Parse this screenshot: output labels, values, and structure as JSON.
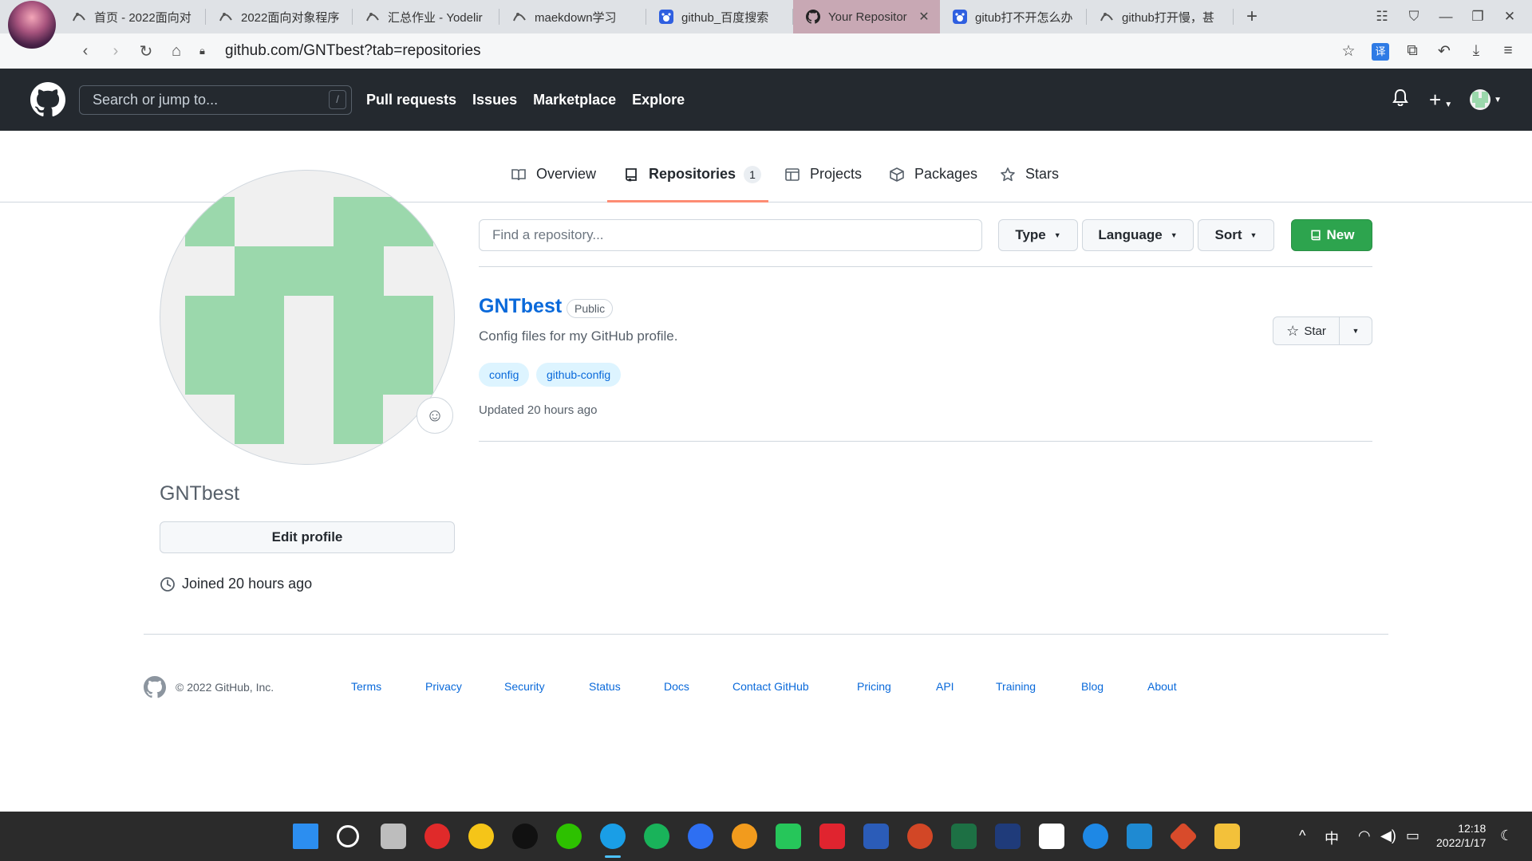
{
  "browser": {
    "tabs": [
      {
        "label": "首页 - 2022面向对",
        "icon": "yuque-icon",
        "active": false,
        "show_close": false
      },
      {
        "label": "2022面向对象程序",
        "icon": "yuque-icon",
        "active": false,
        "show_close": false
      },
      {
        "label": "汇总作业 - Yodelir",
        "icon": "yuque-icon",
        "active": false,
        "show_close": false
      },
      {
        "label": "maekdown学习",
        "icon": "yuque-icon",
        "active": false,
        "show_close": false
      },
      {
        "label": "github_百度搜索",
        "icon": "baidu-icon",
        "active": false,
        "show_close": false
      },
      {
        "label": "Your Repositor",
        "icon": "github-icon",
        "active": true,
        "show_close": true
      },
      {
        "label": "gitub打不开怎么办",
        "icon": "baidu-icon",
        "active": false,
        "show_close": false
      },
      {
        "label": "github打开慢，甚",
        "icon": "yuque-icon",
        "active": false,
        "show_close": false
      }
    ],
    "new_tab_glyph": "+",
    "url": "github.com/GNTbest?tab=repositories",
    "translate_label": "译"
  },
  "header": {
    "search_placeholder": "Search or jump to...",
    "search_shortcut": "/",
    "nav": [
      "Pull requests",
      "Issues",
      "Marketplace",
      "Explore"
    ]
  },
  "profile_tabs": {
    "overview": "Overview",
    "repositories": "Repositories",
    "repositories_count": "1",
    "projects": "Projects",
    "packages": "Packages",
    "stars": "Stars"
  },
  "profile": {
    "username": "GNTbest",
    "edit_label": "Edit profile",
    "joined": "Joined 20 hours ago",
    "avatar_color": "#9bd8ac"
  },
  "repo_filters": {
    "find_placeholder": "Find a repository...",
    "type_label": "Type",
    "language_label": "Language",
    "sort_label": "Sort",
    "new_label": "New"
  },
  "repo": {
    "name": "GNTbest",
    "visibility": "Public",
    "description": "Config files for my GitHub profile.",
    "topics": [
      "config",
      "github-config"
    ],
    "updated": "Updated 20 hours ago",
    "star_label": "Star"
  },
  "footer": {
    "copyright": "© 2022 GitHub, Inc.",
    "links": [
      "Terms",
      "Privacy",
      "Security",
      "Status",
      "Docs",
      "Contact GitHub",
      "Pricing",
      "API",
      "Training",
      "Blog",
      "About"
    ]
  },
  "taskbar": {
    "ime": "中",
    "time": "12:18",
    "date": "2022/1/17"
  },
  "colors": {
    "gh_header": "#24292f",
    "link_blue": "#0969da",
    "new_green": "#2da44e",
    "active_tab_underline": "#fd8c73"
  }
}
